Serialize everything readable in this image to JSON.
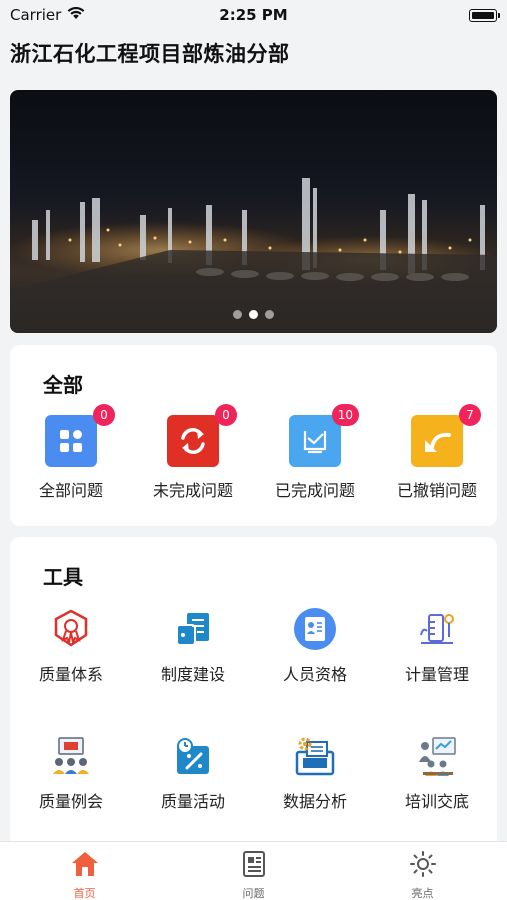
{
  "status_bar": {
    "carrier": "Carrier",
    "time": "2:25 PM"
  },
  "header": {
    "title": "浙江石化工程项目部炼油分部"
  },
  "banner": {
    "slide_count": 3,
    "active_slide": 1
  },
  "all_section": {
    "title": "全部",
    "items": [
      {
        "label": "全部问题",
        "badge": "0",
        "icon": "grid-icon",
        "color": "#4a8cf0"
      },
      {
        "label": "未完成问题",
        "badge": "0",
        "icon": "refresh-arrows-icon",
        "color": "#e03025"
      },
      {
        "label": "已完成问题",
        "badge": "10",
        "icon": "inbox-check-icon",
        "color": "#4aa6ee"
      },
      {
        "label": "已撤销问题",
        "badge": "7",
        "icon": "undo-arrow-icon",
        "color": "#f5b21c"
      }
    ]
  },
  "tools_section": {
    "title": "工具",
    "items": [
      {
        "label": "质量体系",
        "icon": "award-badge-icon"
      },
      {
        "label": "制度建设",
        "icon": "document-stack-icon"
      },
      {
        "label": "人员资格",
        "icon": "id-card-icon"
      },
      {
        "label": "计量管理",
        "icon": "measurement-icon"
      },
      {
        "label": "质量例会",
        "icon": "meeting-icon"
      },
      {
        "label": "质量活动",
        "icon": "activity-timer-icon"
      },
      {
        "label": "数据分析",
        "icon": "data-analysis-icon"
      },
      {
        "label": "培训交底",
        "icon": "training-icon"
      }
    ]
  },
  "tabbar": {
    "tabs": [
      {
        "label": "首页",
        "icon": "home-icon",
        "active": true
      },
      {
        "label": "问题",
        "icon": "newspaper-icon",
        "active": false
      },
      {
        "label": "亮点",
        "icon": "sun-icon",
        "active": false
      }
    ]
  },
  "colors": {
    "accent": "#f0603c",
    "badge": "#f0245a"
  }
}
